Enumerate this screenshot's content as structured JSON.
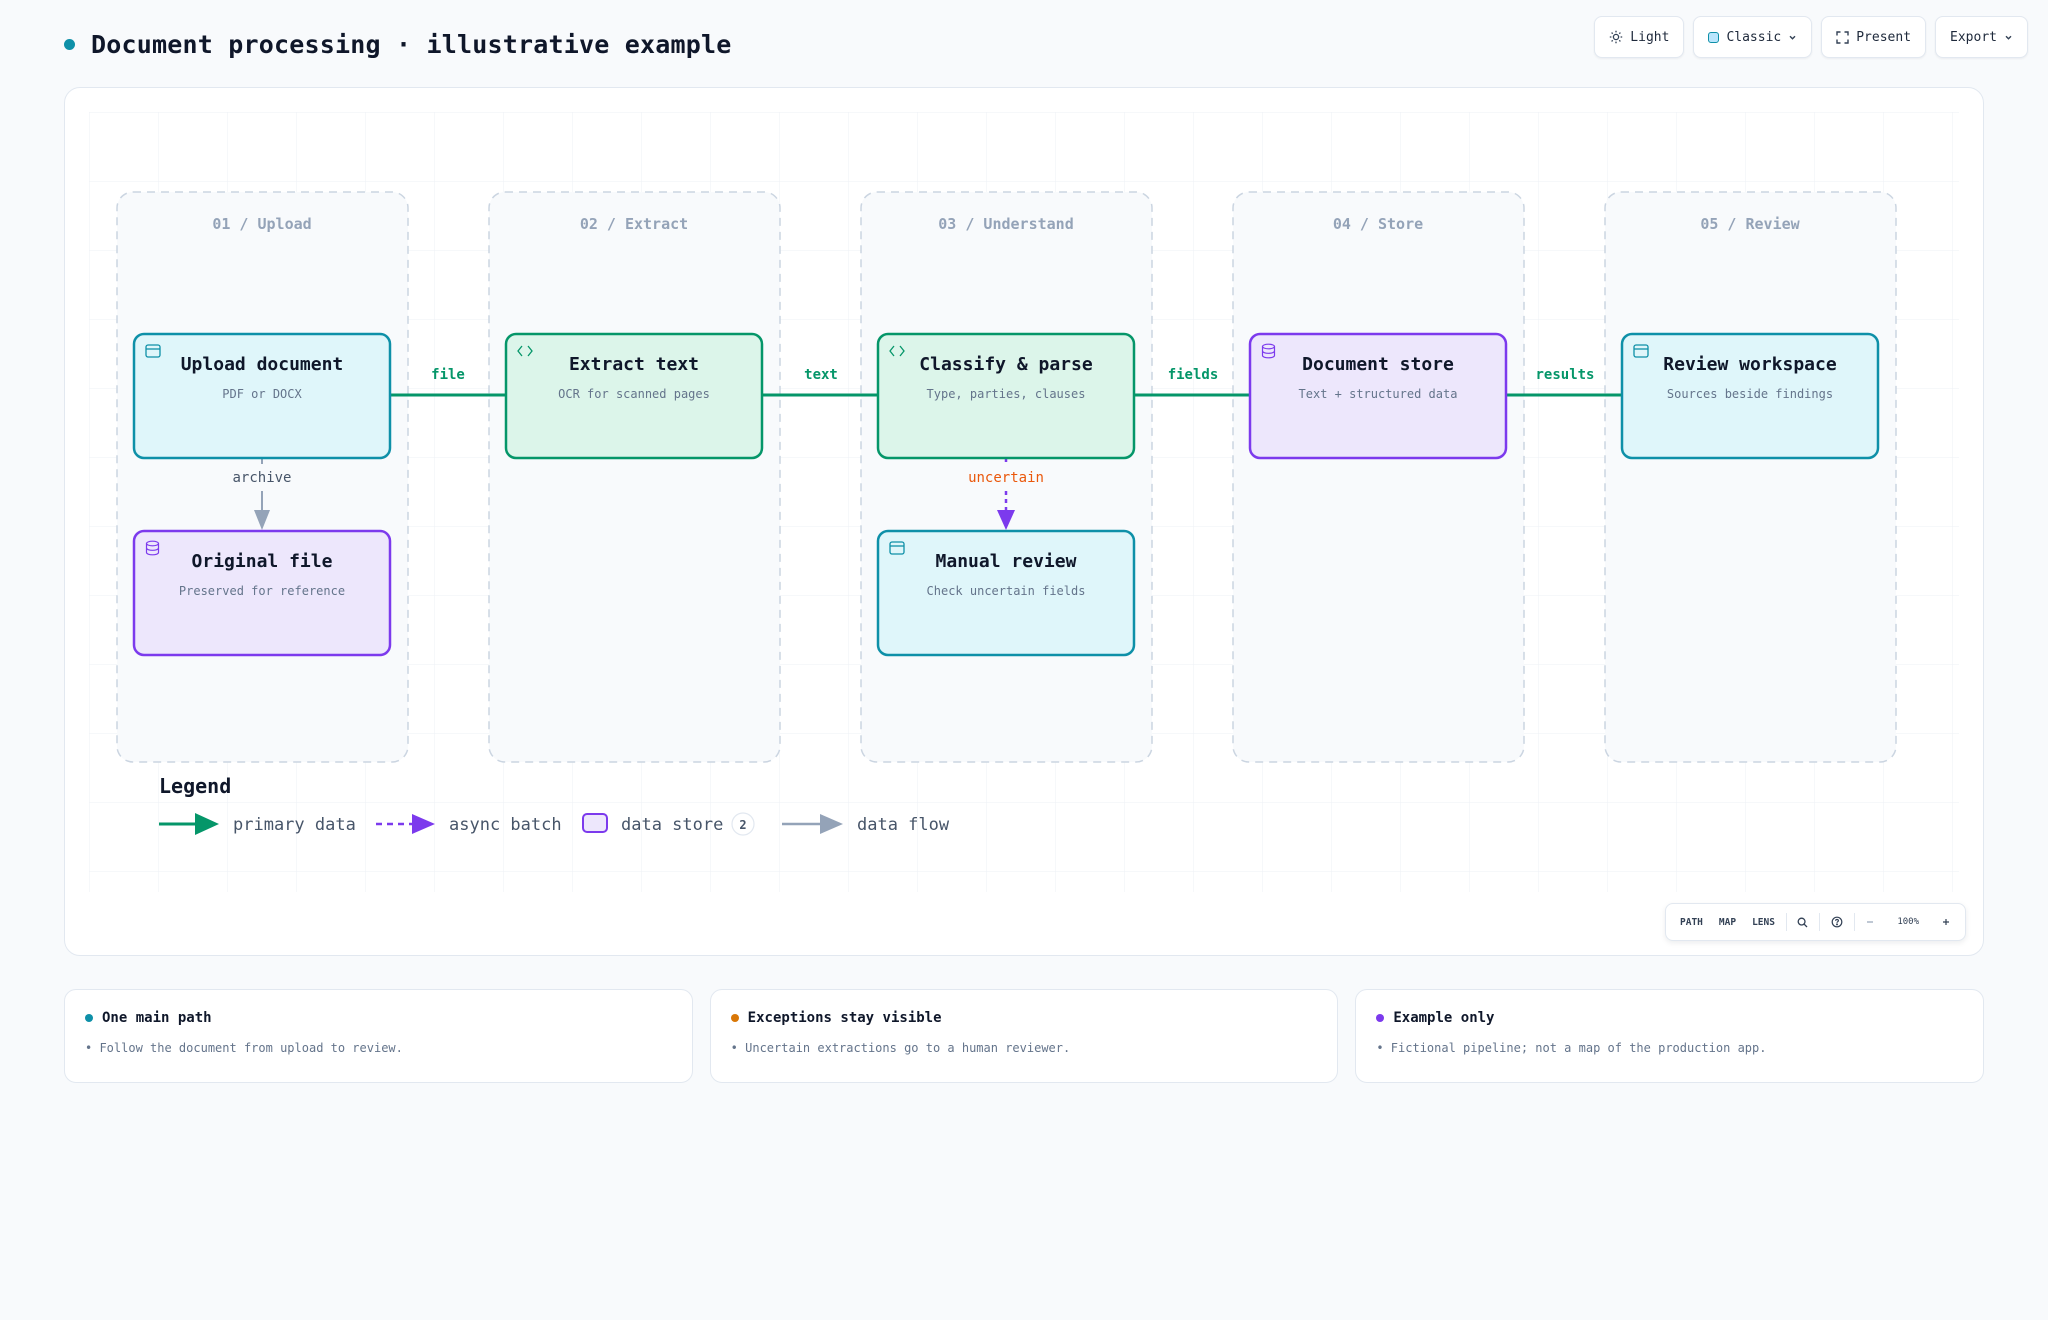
{
  "header": {
    "title": "Document processing · illustrative example",
    "accent": "#0e90a8"
  },
  "toolbar": {
    "light_label": "Light",
    "theme_label": "Classic",
    "present_label": "Present",
    "export_label": "Export"
  },
  "lanes": [
    {
      "label": "01 / Upload"
    },
    {
      "label": "02 / Extract"
    },
    {
      "label": "03 / Understand"
    },
    {
      "label": "04 / Store"
    },
    {
      "label": "05 / Review"
    }
  ],
  "nodes": {
    "upload": {
      "title": "Upload document",
      "subtitle": "PDF or DOCX",
      "icon": "window-icon",
      "kind": "interface"
    },
    "extract": {
      "title": "Extract text",
      "subtitle": "OCR for scanned pages",
      "icon": "code-icon",
      "kind": "process"
    },
    "classify": {
      "title": "Classify & parse",
      "subtitle": "Type, parties, clauses",
      "icon": "code-icon",
      "kind": "process"
    },
    "store": {
      "title": "Document store",
      "subtitle": "Text + structured data",
      "icon": "database-icon",
      "kind": "store"
    },
    "review": {
      "title": "Review workspace",
      "subtitle": "Sources beside findings",
      "icon": "window-icon",
      "kind": "interface"
    },
    "original": {
      "title": "Original file",
      "subtitle": "Preserved for reference",
      "icon": "database-icon",
      "kind": "store"
    },
    "manual": {
      "title": "Manual review",
      "subtitle": "Check uncertain fields",
      "icon": "window-icon",
      "kind": "interface"
    }
  },
  "edges": {
    "file": "file",
    "text": "text",
    "fields": "fields",
    "results": "results",
    "archive": "archive",
    "uncertain": "uncertain"
  },
  "legend": {
    "title": "Legend",
    "primary": "primary data",
    "async": "async batch",
    "store": "data store",
    "store_count": "2",
    "flow": "data flow"
  },
  "zoom": {
    "path": "PATH",
    "map": "MAP",
    "lens": "LENS",
    "level": "100%"
  },
  "notes": [
    {
      "title": "One main path",
      "body": "• Follow the document from upload to review.",
      "color": "#0e90a8"
    },
    {
      "title": "Exceptions stay visible",
      "body": "• Uncertain extractions go to a human reviewer.",
      "color": "#d97706"
    },
    {
      "title": "Example only",
      "body": "• Fictional pipeline; not a map of the production app.",
      "color": "#7c3aed"
    }
  ],
  "colors": {
    "primary": "#059669",
    "async": "#7c3aed",
    "flow": "#94a3b8",
    "interface_border": "#0e90a8",
    "interface_fill": "#dff6fa",
    "process_border": "#059669",
    "process_fill": "#dcf5ea",
    "store_border": "#7c3aed",
    "store_fill": "#ede7fc",
    "warning": "#ea580c"
  }
}
